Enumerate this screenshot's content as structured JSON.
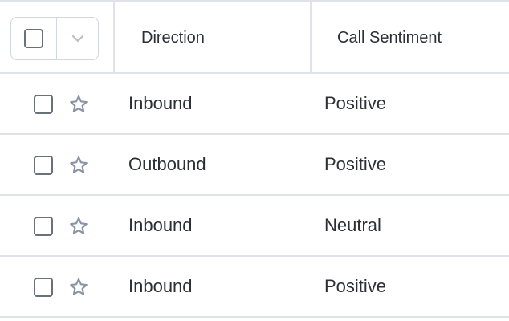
{
  "header": {
    "direction": "Direction",
    "call_sentiment": "Call Sentiment"
  },
  "icons": {
    "checkbox": "checkbox-icon",
    "dropdown": "chevron-down-icon",
    "star": "star-icon"
  },
  "colors": {
    "border": "#dfe3e8",
    "star": "#8a94a6",
    "text": "#2b2f36"
  },
  "rows": [
    {
      "direction": "Inbound",
      "sentiment": "Positive"
    },
    {
      "direction": "Outbound",
      "sentiment": "Positive"
    },
    {
      "direction": "Inbound",
      "sentiment": "Neutral"
    },
    {
      "direction": "Inbound",
      "sentiment": "Positive"
    }
  ]
}
